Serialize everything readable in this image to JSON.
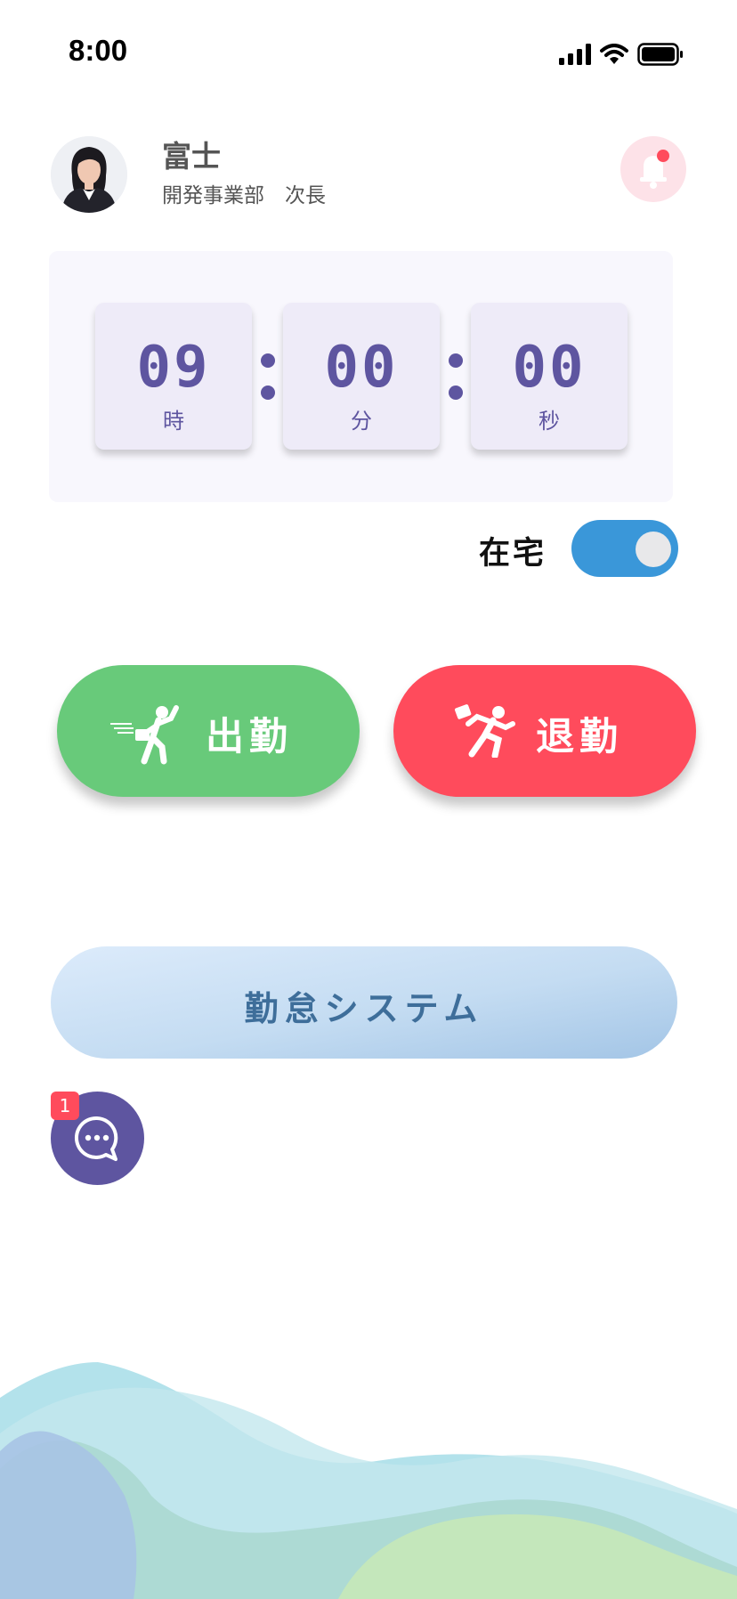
{
  "status_bar": {
    "time": "8:00"
  },
  "profile": {
    "name": "富士",
    "department": "開発事業部　次長"
  },
  "clock": {
    "hours": "09",
    "minutes": "00",
    "seconds": "00",
    "hours_label": "時",
    "minutes_label": "分",
    "seconds_label": "秒"
  },
  "remote": {
    "label": "在宅",
    "enabled": true
  },
  "actions": {
    "clock_in_label": "出勤",
    "clock_out_label": "退勤"
  },
  "system_button": {
    "label": "勤怠システム"
  },
  "chat": {
    "badge_count": "1"
  },
  "colors": {
    "accent": "#5e55a0",
    "clock_in": "#68ca7a",
    "clock_out": "#ff4b5c",
    "toggle_on": "#3a97d9"
  },
  "icons": [
    "signal-icon",
    "wifi-icon",
    "battery-icon",
    "bell-icon",
    "clock-in-runner-icon",
    "clock-out-runner-icon",
    "chat-icon"
  ]
}
